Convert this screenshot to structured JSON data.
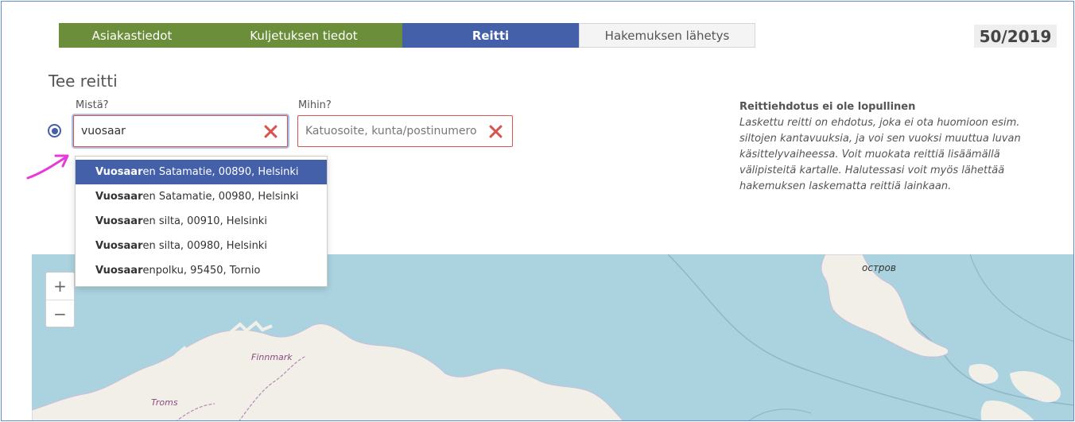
{
  "steps": [
    {
      "label": "Asiakastiedot",
      "state": "done"
    },
    {
      "label": "Kuljetuksen tiedot",
      "state": "done"
    },
    {
      "label": "Reitti",
      "state": "active"
    },
    {
      "label": "Hakemuksen lähetys",
      "state": "todo"
    }
  ],
  "case_number": "50/2019",
  "page_title": "Tee reitti",
  "from": {
    "label": "Mistä?",
    "value": "vuosaar"
  },
  "to": {
    "label": "Mihin?",
    "placeholder": "Katuosoite, kunta/postinumero"
  },
  "info": {
    "title": "Reittiehdotus ei ole lopullinen",
    "body": "Laskettu reitti on ehdotus, joka ei ota huomioon esim. siltojen kantavuuksia, ja voi sen vuoksi muuttua luvan käsittelyvaiheessa. Voit muokata reittiä lisäämällä välipisteitä kartalle. Halutessasi voit myös lähettää hakemuksen laskematta reittiä lainkaan."
  },
  "suggestions": [
    {
      "match": "Vuosaar",
      "rest": "en Satamatie, 00890, Helsinki",
      "selected": true
    },
    {
      "match": "Vuosaar",
      "rest": "en Satamatie, 00980, Helsinki",
      "selected": false
    },
    {
      "match": "Vuosaar",
      "rest": "en silta, 00910, Helsinki",
      "selected": false
    },
    {
      "match": "Vuosaar",
      "rest": "en silta, 00980, Helsinki",
      "selected": false
    },
    {
      "match": "Vuosaar",
      "rest": "enpolku, 95450, Tornio",
      "selected": false
    }
  ],
  "map": {
    "zoom_in": "+",
    "zoom_out": "−",
    "labels": {
      "ostrov": "остров",
      "finnmark": "Finnmark",
      "troms": "Troms"
    }
  },
  "colors": {
    "step_done": "#6b8e3a",
    "step_active": "#4360a9",
    "error": "#d9534f",
    "water": "#aad3df",
    "land": "#f2efe9",
    "annotation": "#e83ad8"
  }
}
